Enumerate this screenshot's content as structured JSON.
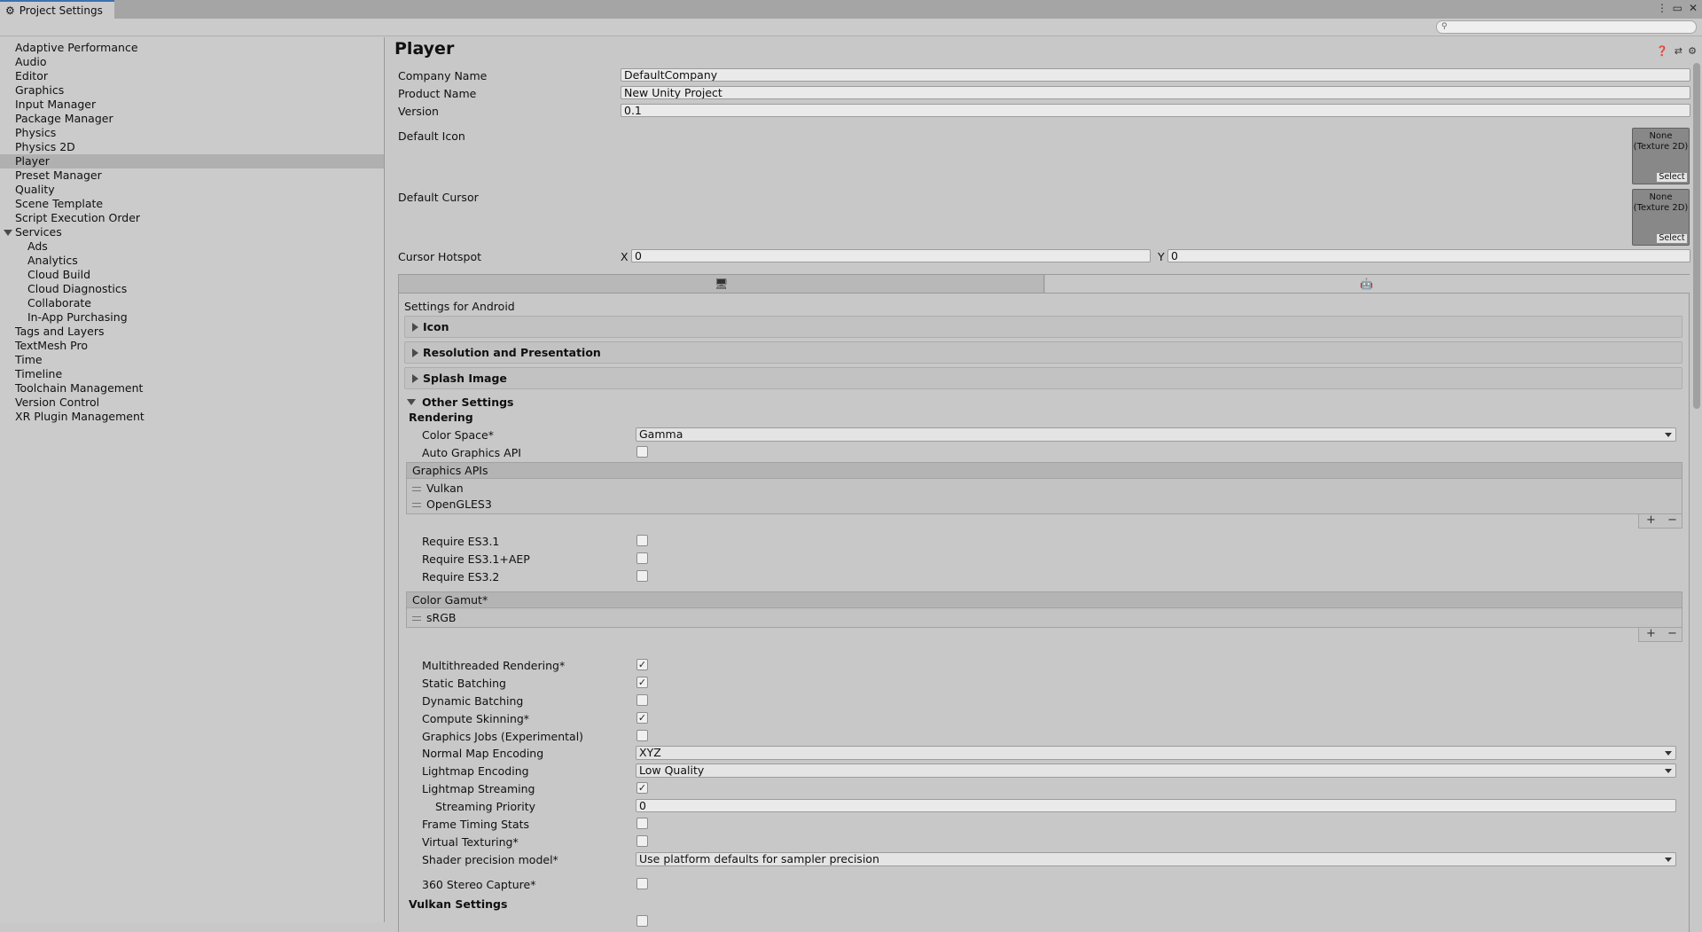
{
  "window": {
    "tab_title": "Project Settings",
    "tab_icon": "gear-icon",
    "controls": [
      "more-options-icon",
      "maximize-icon",
      "close-icon"
    ]
  },
  "toolbar": {
    "search_placeholder": ""
  },
  "sidebar": {
    "items": [
      {
        "label": "Adaptive Performance"
      },
      {
        "label": "Audio"
      },
      {
        "label": "Editor"
      },
      {
        "label": "Graphics"
      },
      {
        "label": "Input Manager"
      },
      {
        "label": "Package Manager"
      },
      {
        "label": "Physics"
      },
      {
        "label": "Physics 2D"
      },
      {
        "label": "Player",
        "selected": true
      },
      {
        "label": "Preset Manager"
      },
      {
        "label": "Quality"
      },
      {
        "label": "Scene Template"
      },
      {
        "label": "Script Execution Order"
      },
      {
        "label": "Services",
        "expanded": true
      },
      {
        "label": "Ads",
        "child": true
      },
      {
        "label": "Analytics",
        "child": true
      },
      {
        "label": "Cloud Build",
        "child": true
      },
      {
        "label": "Cloud Diagnostics",
        "child": true
      },
      {
        "label": "Collaborate",
        "child": true
      },
      {
        "label": "In-App Purchasing",
        "child": true
      },
      {
        "label": "Tags and Layers"
      },
      {
        "label": "TextMesh Pro"
      },
      {
        "label": "Time"
      },
      {
        "label": "Timeline"
      },
      {
        "label": "Toolchain Management"
      },
      {
        "label": "Version Control"
      },
      {
        "label": "XR Plugin Management"
      }
    ]
  },
  "player": {
    "title": "Player",
    "company_label": "Company Name",
    "company_value": "DefaultCompany",
    "product_label": "Product Name",
    "product_value": "New Unity Project",
    "version_label": "Version",
    "version_value": "0.1",
    "icon_label": "Default Icon",
    "cursor_label": "Default Cursor",
    "object_none": "None",
    "object_type": "(Texture 2D)",
    "object_select": "Select",
    "hotspot_label": "Cursor Hotspot",
    "hotspot_x_label": "X",
    "hotspot_x": "0",
    "hotspot_y_label": "Y",
    "hotspot_y": "0"
  },
  "platform": {
    "settings_for": "Settings for Android",
    "sections": [
      "Icon",
      "Resolution and Presentation",
      "Splash Image",
      "Other Settings"
    ]
  },
  "other": {
    "rendering_header": "Rendering",
    "color_space_label": "Color Space*",
    "color_space_value": "Gamma",
    "auto_graphics_label": "Auto Graphics API",
    "auto_graphics_checked": false,
    "graphics_apis_header": "Graphics APIs",
    "graphics_apis": [
      "Vulkan",
      "OpenGLES3"
    ],
    "require_es31_label": "Require ES3.1",
    "require_es31aep_label": "Require ES3.1+AEP",
    "require_es32_label": "Require ES3.2",
    "color_gamut_header": "Color Gamut*",
    "color_gamut": [
      "sRGB"
    ],
    "toggles": [
      {
        "label": "Multithreaded Rendering*",
        "checked": true
      },
      {
        "label": "Static Batching",
        "checked": true
      },
      {
        "label": "Dynamic Batching",
        "checked": false
      },
      {
        "label": "Compute Skinning*",
        "checked": true
      },
      {
        "label": "Graphics Jobs (Experimental)",
        "checked": false
      }
    ],
    "normal_map_label": "Normal Map Encoding",
    "normal_map_value": "XYZ",
    "lightmap_enc_label": "Lightmap Encoding",
    "lightmap_enc_value": "Low Quality",
    "lightmap_stream_label": "Lightmap Streaming",
    "lightmap_stream_checked": true,
    "stream_priority_label": "Streaming Priority",
    "stream_priority_value": "0",
    "frame_timing_label": "Frame Timing Stats",
    "virtual_tex_label": "Virtual Texturing*",
    "shader_prec_label": "Shader precision model*",
    "shader_prec_value": "Use platform defaults for sampler precision",
    "stereo_label": "360 Stereo Capture*",
    "vulkan_header": "Vulkan Settings",
    "plus_symbol": "+",
    "minus_symbol": "−"
  }
}
